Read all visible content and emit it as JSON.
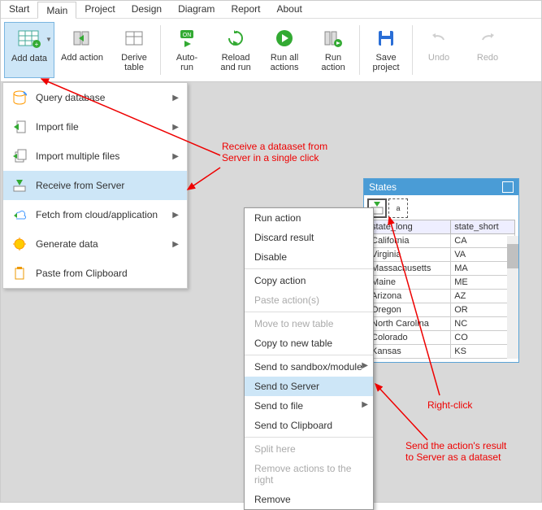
{
  "menubar": {
    "tabs": [
      "Start",
      "Main",
      "Project",
      "Design",
      "Diagram",
      "Report",
      "About"
    ],
    "active": 1
  },
  "ribbon": [
    {
      "label": "Add data",
      "active": true,
      "dropdown": true,
      "icon": "table-add"
    },
    {
      "label": "Add action",
      "icon": "action"
    },
    {
      "label": "Derive\ntable",
      "icon": "table"
    },
    {
      "sep": true
    },
    {
      "label": "Auto-\nrun",
      "icon": "auto"
    },
    {
      "label": "Reload\nand run",
      "icon": "reload"
    },
    {
      "label": "Run all\nactions",
      "icon": "play"
    },
    {
      "label": "Run\naction",
      "icon": "play2"
    },
    {
      "sep": true
    },
    {
      "label": "Save\nproject",
      "icon": "save"
    },
    {
      "sep": true
    },
    {
      "label": "Undo",
      "icon": "undo",
      "dim": true
    },
    {
      "label": "Redo",
      "icon": "redo",
      "dim": true
    }
  ],
  "dropdown": [
    {
      "label": "Query database",
      "arrow": true,
      "icon": "db"
    },
    {
      "label": "Import file",
      "arrow": true,
      "icon": "import"
    },
    {
      "label": "Import multiple files",
      "arrow": true,
      "icon": "import-multi"
    },
    {
      "label": "Receive from Server",
      "hl": true,
      "icon": "recv"
    },
    {
      "label": "Fetch from cloud/application",
      "arrow": true,
      "icon": "cloud"
    },
    {
      "label": "Generate data",
      "arrow": true,
      "icon": "gen"
    },
    {
      "label": "Paste from Clipboard",
      "icon": "paste"
    }
  ],
  "ctx": [
    {
      "label": "Run action"
    },
    {
      "label": "Discard result"
    },
    {
      "label": "Disable"
    },
    {
      "sep": true
    },
    {
      "label": "Copy action"
    },
    {
      "label": "Paste action(s)",
      "dis": true
    },
    {
      "sep": true
    },
    {
      "label": "Move to new table",
      "dis": true
    },
    {
      "label": "Copy to new table"
    },
    {
      "sep": true
    },
    {
      "label": "Send to sandbox/module",
      "arrow": true
    },
    {
      "label": "Send to Server",
      "hl": true
    },
    {
      "label": "Send to file",
      "arrow": true
    },
    {
      "label": "Send to Clipboard"
    },
    {
      "sep": true
    },
    {
      "label": "Split here",
      "dis": true
    },
    {
      "label": "Remove actions to the right",
      "dis": true
    },
    {
      "label": "Remove"
    }
  ],
  "tablewin": {
    "title": "States",
    "tool_label": "a",
    "columns": [
      "state_long",
      "state_short"
    ],
    "rows": [
      [
        "California",
        "CA"
      ],
      [
        "Virginia",
        "VA"
      ],
      [
        "Massachusetts",
        "MA"
      ],
      [
        "Maine",
        "ME"
      ],
      [
        "Arizona",
        "AZ"
      ],
      [
        "Oregon",
        "OR"
      ],
      [
        "North Carolina",
        "NC"
      ],
      [
        "Colorado",
        "CO"
      ],
      [
        "Kansas",
        "KS"
      ]
    ]
  },
  "annotations": {
    "a1": "Receive a dataaset from\nServer in a single click",
    "a2": "Right-click",
    "a3": "Send the action's result\nto Server as a dataset"
  }
}
